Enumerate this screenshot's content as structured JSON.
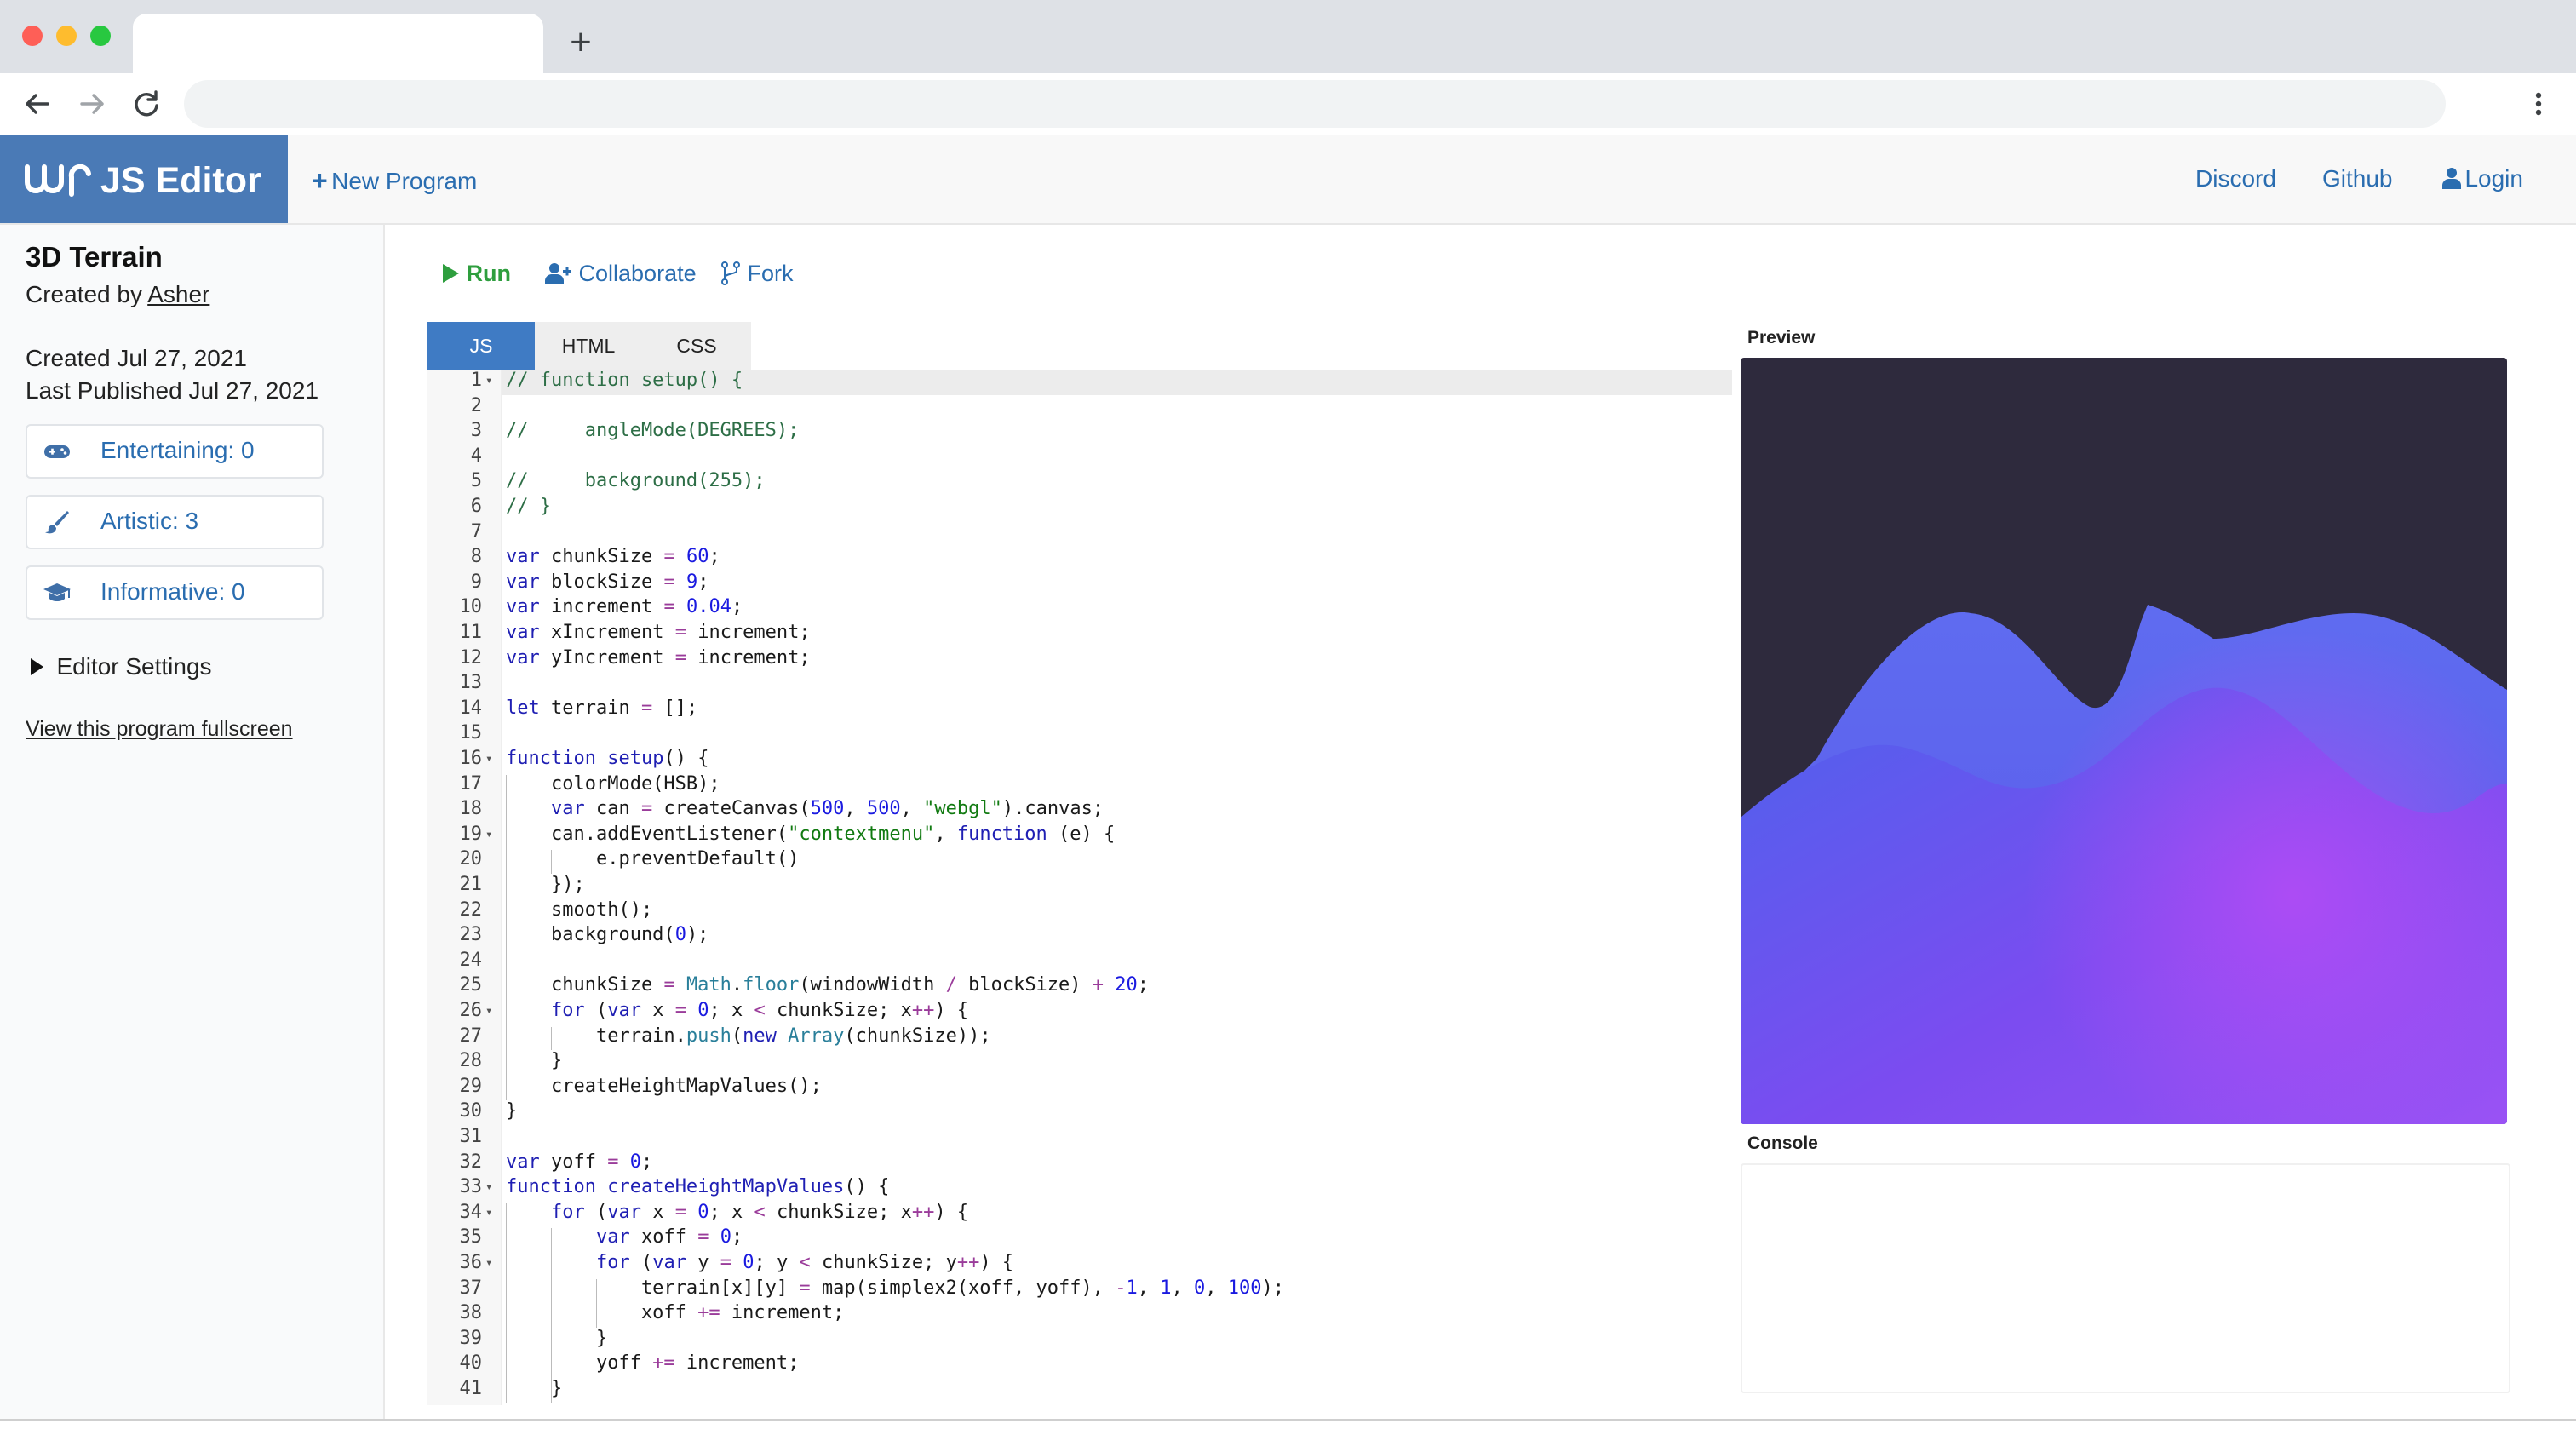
{
  "browser": {
    "new_tab_symbol": "+",
    "traffic_lights": [
      "#fe5f57",
      "#febc2e",
      "#28c840"
    ]
  },
  "nav": {
    "brand": "JS Editor",
    "new_program": "New Program",
    "discord": "Discord",
    "github": "Github",
    "login": "Login",
    "brand_color": "#4a7ab6",
    "link_color": "#2a6db0"
  },
  "program": {
    "title": "3D Terrain",
    "created_by_prefix": "Created by",
    "author": "Asher",
    "created": "Created Jul 27, 2021",
    "published": "Last Published Jul 27, 2021"
  },
  "ratings": [
    {
      "label": "Entertaining: 0",
      "icon": "gamepad-icon"
    },
    {
      "label": "Artistic: 3",
      "icon": "paintbrush-icon"
    },
    {
      "label": "Informative: 0",
      "icon": "graduation-cap-icon"
    }
  ],
  "editor_settings": "Editor Settings",
  "fullscreen_link": "View this program fullscreen",
  "actions": {
    "run": "Run",
    "collaborate": "Collaborate",
    "fork": "Fork"
  },
  "tabs": [
    "JS",
    "HTML",
    "CSS"
  ],
  "panels": {
    "preview": "Preview",
    "console": "Console"
  },
  "code_lines": [
    "// function setup() {",
    "",
    "//     angleMode(DEGREES);",
    "",
    "//     background(255);",
    "// }",
    "",
    "var chunkSize = 60;",
    "var blockSize = 9;",
    "var increment = 0.04;",
    "var xIncrement = increment;",
    "var yIncrement = increment;",
    "",
    "let terrain = [];",
    "",
    "function setup() {",
    "    colorMode(HSB);",
    "    var can = createCanvas(500, 500, \"webgl\").canvas;",
    "    can.addEventListener(\"contextmenu\", function (e) {",
    "        e.preventDefault()",
    "    });",
    "    smooth();",
    "    background(0);",
    "",
    "    chunkSize = Math.floor(windowWidth / blockSize) + 20;",
    "    for (var x = 0; x < chunkSize; x++) {",
    "        terrain.push(new Array(chunkSize));",
    "    }",
    "    createHeightMapValues();",
    "}",
    "",
    "var yoff = 0;",
    "function createHeightMapValues() {",
    "    for (var x = 0; x < chunkSize; x++) {",
    "        var xoff = 0;",
    "        for (var y = 0; y < chunkSize; y++) {",
    "            terrain[x][y] = map(simplex2(xoff, yoff), -1, 1, 0, 100);",
    "            xoff += increment;",
    "        }",
    "        yoff += increment;",
    "    }"
  ],
  "fold_lines": [
    1,
    16,
    19,
    26,
    33,
    34,
    36
  ]
}
